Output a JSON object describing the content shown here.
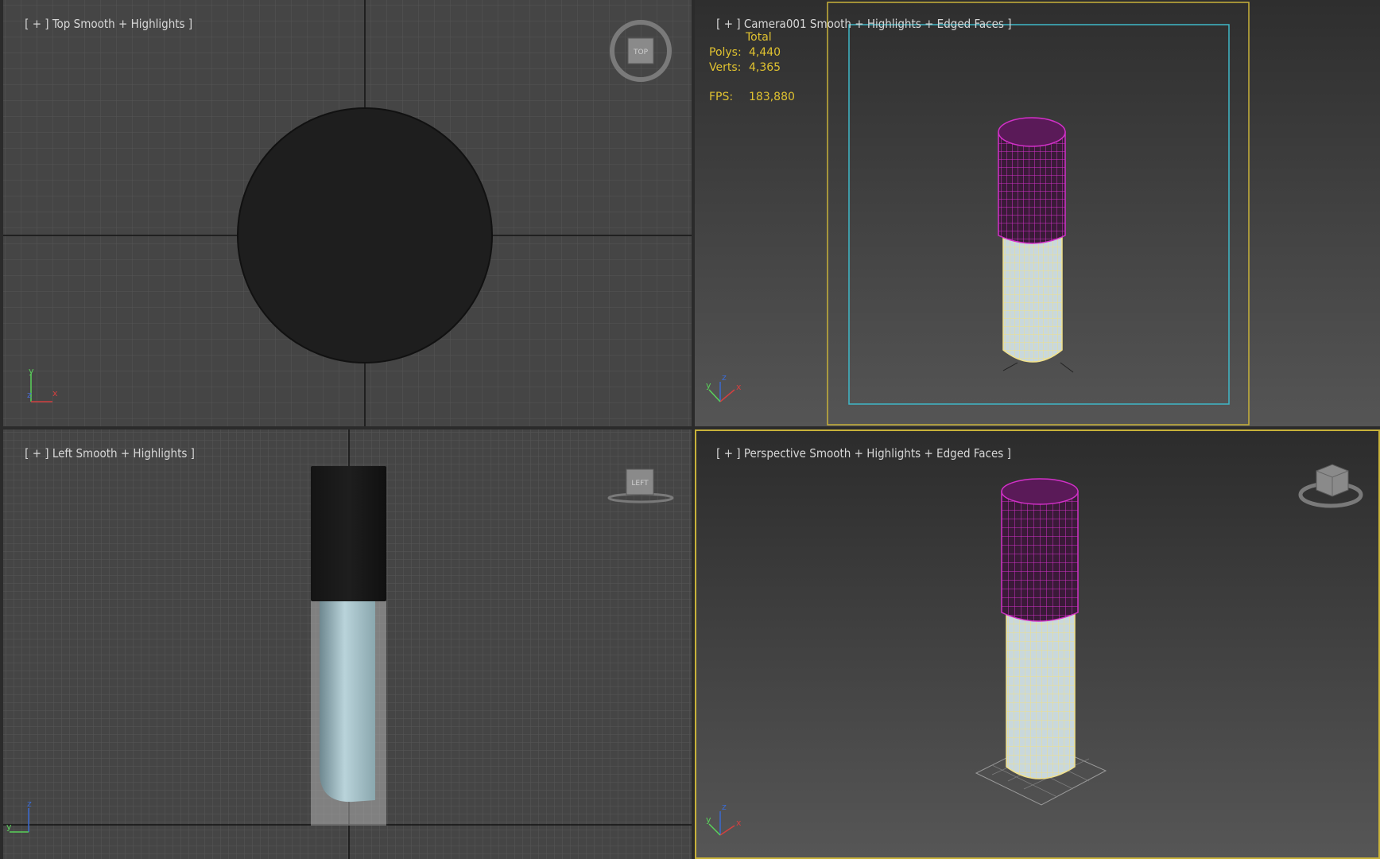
{
  "viewports": {
    "top": {
      "bracket_open": "[ + ]",
      "name": "Top",
      "shading": "Smooth + Highlights ]",
      "viewcube_label": "TOP"
    },
    "camera": {
      "bracket_open": "[ + ]",
      "name": "Camera001",
      "shading": "Smooth + Highlights + Edged Faces ]"
    },
    "left": {
      "bracket_open": "[ + ]",
      "name": "Left",
      "shading": "Smooth + Highlights ]",
      "viewcube_label": "LEFT"
    },
    "perspective": {
      "bracket_open": "[ + ]",
      "name": "Perspective",
      "shading": "Smooth + Highlights + Edged Faces ]"
    }
  },
  "stats": {
    "header": "Total",
    "polys_label": "Polys:",
    "polys_value": "4,440",
    "verts_label": "Verts:",
    "verts_value": "4,365",
    "fps_label": "FPS:",
    "fps_value": "183,880"
  },
  "axis_labels": {
    "x": "x",
    "y": "y",
    "z": "z"
  },
  "colors": {
    "viewport_bg": "#454545",
    "grid_minor": "#505050",
    "grid_major": "#1a1a1a",
    "active_border": "#c8b23a",
    "safe_frame_outer": "#c8b23a",
    "safe_frame_inner": "#3fb8c8",
    "cap_wire": "#d230c8",
    "body_wire": "#f0e08a",
    "stats_text": "#e0c230"
  }
}
